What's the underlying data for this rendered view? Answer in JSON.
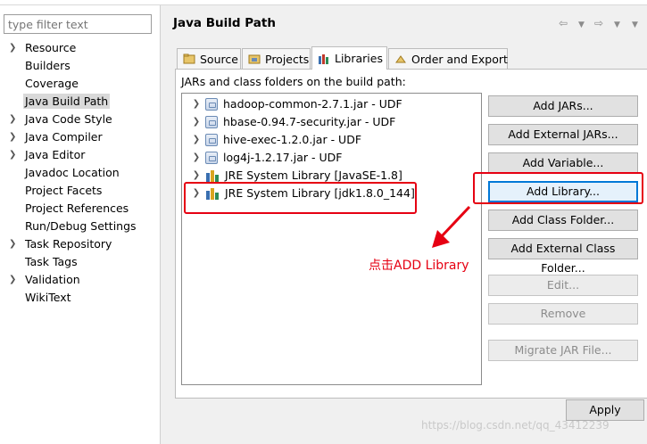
{
  "filter": {
    "placeholder": "type filter text"
  },
  "nav": [
    {
      "label": "Resource",
      "expandable": true
    },
    {
      "label": "Builders",
      "expandable": false
    },
    {
      "label": "Coverage",
      "expandable": false
    },
    {
      "label": "Java Build Path",
      "expandable": false,
      "selected": true
    },
    {
      "label": "Java Code Style",
      "expandable": true
    },
    {
      "label": "Java Compiler",
      "expandable": true
    },
    {
      "label": "Java Editor",
      "expandable": true
    },
    {
      "label": "Javadoc Location",
      "expandable": false
    },
    {
      "label": "Project Facets",
      "expandable": false
    },
    {
      "label": "Project References",
      "expandable": false
    },
    {
      "label": "Run/Debug Settings",
      "expandable": false
    },
    {
      "label": "Task Repository",
      "expandable": true
    },
    {
      "label": "Task Tags",
      "expandable": false
    },
    {
      "label": "Validation",
      "expandable": true
    },
    {
      "label": "WikiText",
      "expandable": false
    }
  ],
  "header": {
    "title": "Java Build Path"
  },
  "tabs": [
    {
      "label": "Source",
      "icon": "source-folder-icon"
    },
    {
      "label": "Projects",
      "icon": "projects-icon"
    },
    {
      "label": "Libraries",
      "icon": "libraries-icon",
      "active": true
    },
    {
      "label": "Order and Export",
      "icon": "order-export-icon"
    }
  ],
  "libraries": {
    "caption": "JARs and class folders on the build path:",
    "items": [
      {
        "label": "hadoop-common-2.7.1.jar - UDF",
        "icon": "jar-icon"
      },
      {
        "label": "hbase-0.94.7-security.jar - UDF",
        "icon": "jar-icon"
      },
      {
        "label": "hive-exec-1.2.0.jar - UDF",
        "icon": "jar-icon"
      },
      {
        "label": "log4j-1.2.17.jar - UDF",
        "icon": "jar-icon"
      },
      {
        "label": "JRE System Library [JavaSE-1.8]",
        "icon": "library-icon"
      },
      {
        "label": "JRE System Library [jdk1.8.0_144]",
        "icon": "library-icon"
      }
    ]
  },
  "buttons": {
    "add_jars": "Add JARs...",
    "add_external_jars": "Add External JARs...",
    "add_variable": "Add Variable...",
    "add_library": "Add Library...",
    "add_class_folder": "Add Class Folder...",
    "add_external_class_folder": "Add External Class Folder...",
    "edit": "Edit...",
    "remove": "Remove",
    "migrate_jar": "Migrate JAR File...",
    "apply": "Apply"
  },
  "annotation": {
    "note": "点击ADD Library",
    "color": "#e60012"
  },
  "watermark": "https://blog.csdn.net/qq_43412239"
}
